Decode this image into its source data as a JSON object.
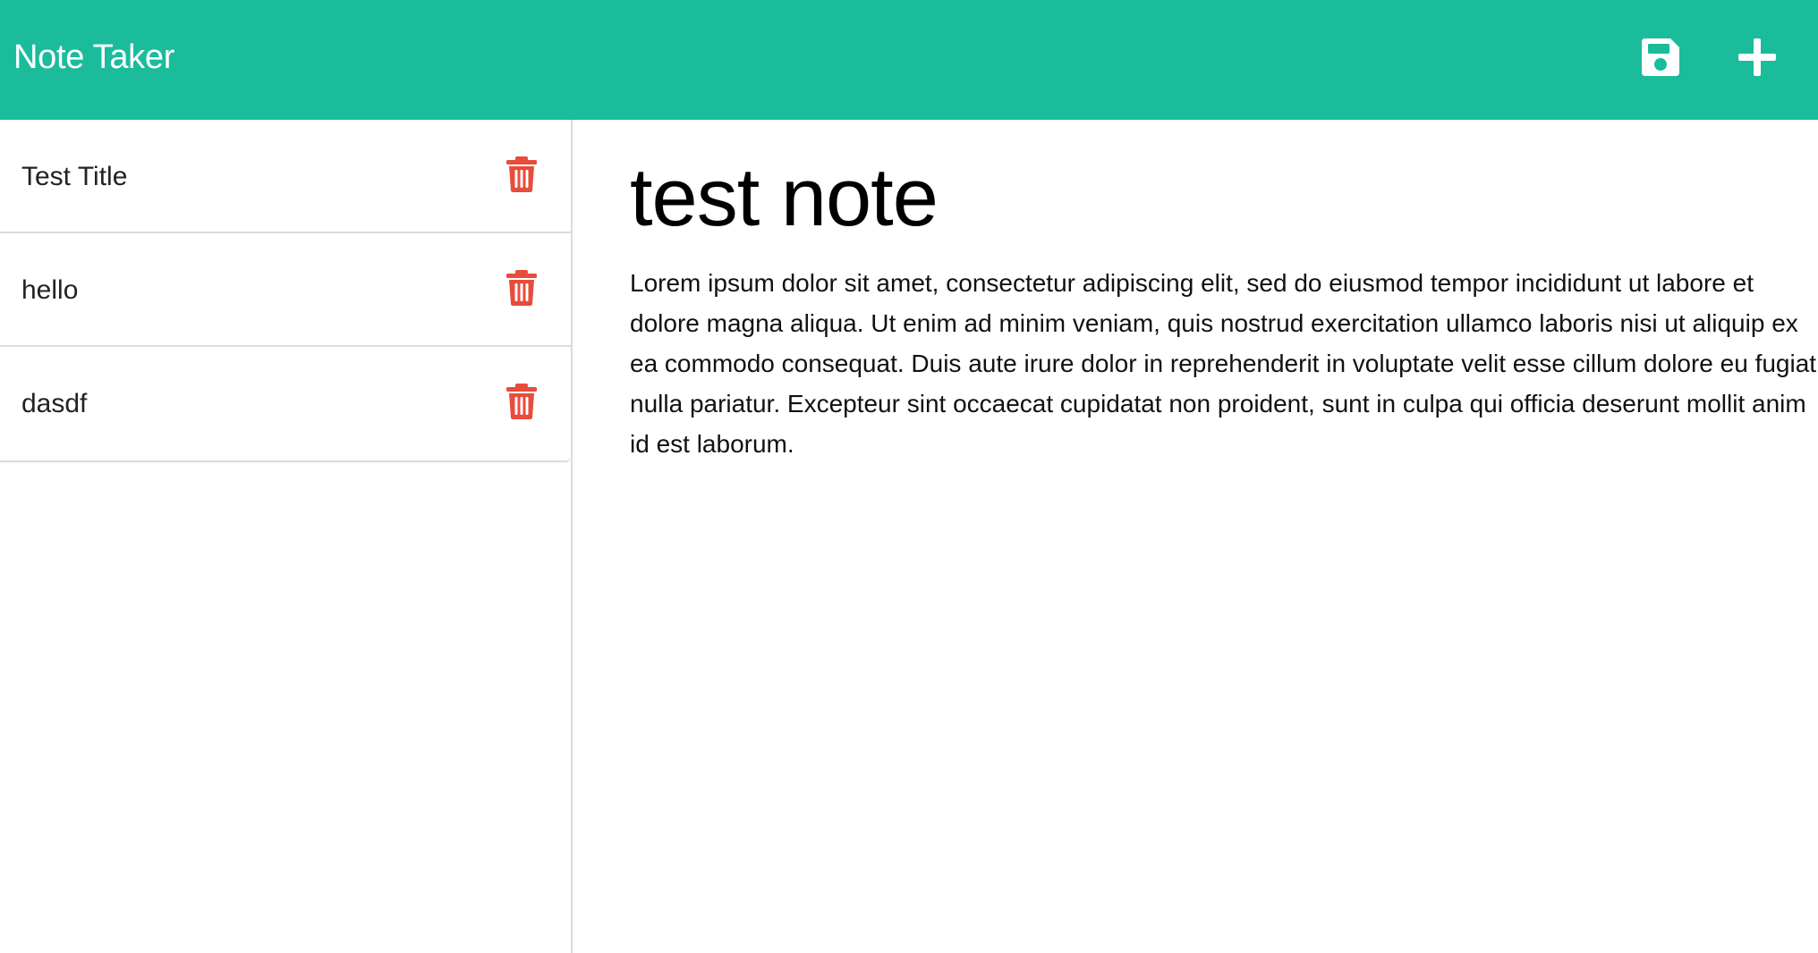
{
  "app": {
    "title": "Note Taker",
    "accent_color": "#1abc9c",
    "danger_color": "#e74c3c"
  },
  "toolbar": {
    "save_icon": "floppy-disk-icon",
    "add_icon": "plus-icon"
  },
  "notes": [
    {
      "title": "Test Title",
      "delete_icon": "trash-icon"
    },
    {
      "title": "hello",
      "delete_icon": "trash-icon"
    },
    {
      "title": "dasdf",
      "delete_icon": "trash-icon"
    }
  ],
  "editor": {
    "title": "test note",
    "body": "Lorem ipsum dolor sit amet, consectetur adipiscing elit, sed do eiusmod tempor incididunt ut labore et dolore magna aliqua. Ut enim ad minim veniam, quis nostrud exercitation ullamco laboris nisi ut aliquip ex ea commodo consequat. Duis aute irure dolor in reprehenderit in voluptate velit esse cillum dolore eu fugiat nulla pariatur. Excepteur sint occaecat cupidatat non proident, sunt in culpa qui officia deserunt mollit anim id est laborum."
  }
}
